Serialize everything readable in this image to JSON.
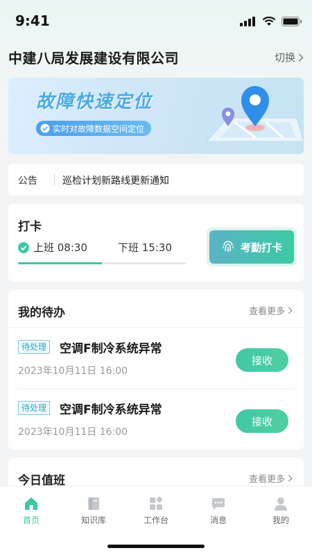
{
  "status": {
    "time": "9:41"
  },
  "header": {
    "company": "中建八局发展建设有限公司",
    "switch_label": "切换"
  },
  "banner": {
    "title": "故障快速定位",
    "subtitle": "实时对故障数据空间定位"
  },
  "notice": {
    "label": "公告",
    "text": "巡检计划新路线更新通知"
  },
  "checkin": {
    "title": "打卡",
    "on_duty": "上班 08:30",
    "off_duty": "下班 15:30",
    "progress": 0.5,
    "button_label": "考勤打卡"
  },
  "todo": {
    "title": "我的待办",
    "see_more": "查看更多",
    "items": [
      {
        "tag": "待处理",
        "title": "空调F制冷系统异常",
        "date": "2023年10月11日 16:00",
        "action": "接收"
      },
      {
        "tag": "待处理",
        "title": "空调F制冷系统异常",
        "date": "2023年10月11日 16:00",
        "action": "接收"
      }
    ]
  },
  "duty": {
    "title": "今日值班",
    "see_more": "查看更多"
  },
  "tabbar": {
    "items": [
      {
        "label": "首页",
        "icon": "home-icon",
        "active": true
      },
      {
        "label": "知识库",
        "icon": "book-icon",
        "active": false
      },
      {
        "label": "工作台",
        "icon": "workbench-icon",
        "active": false
      },
      {
        "label": "消息",
        "icon": "message-icon",
        "active": false
      },
      {
        "label": "我的",
        "icon": "profile-icon",
        "active": false
      }
    ]
  },
  "colors": {
    "accent": "#3dc7a3",
    "banner_blue": "#4aa9e8",
    "tag_blue": "#2fa8c9"
  }
}
